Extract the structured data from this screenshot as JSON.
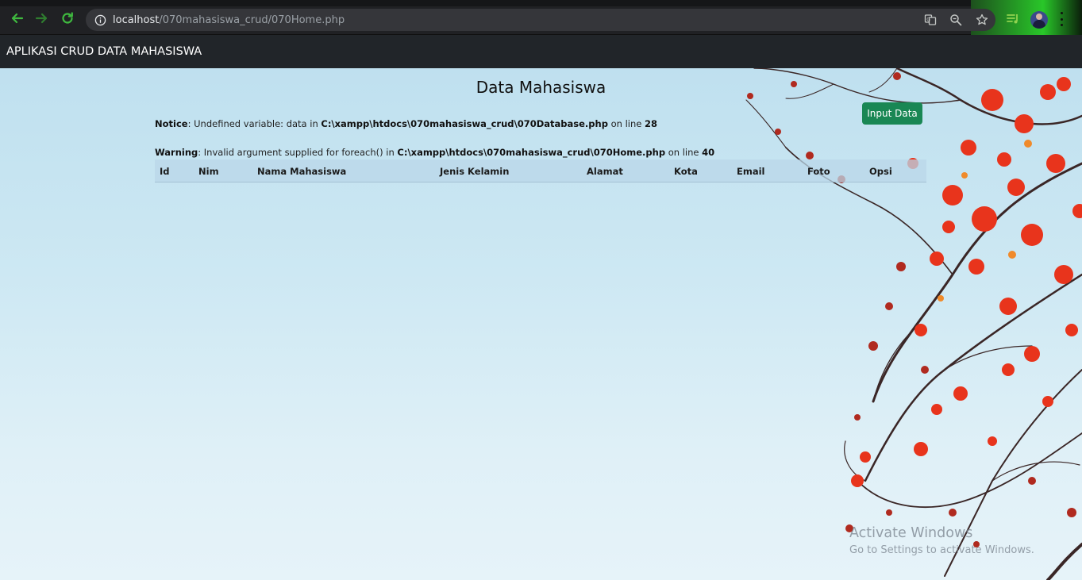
{
  "browser": {
    "url_host": "localhost",
    "url_path": "/070mahasiswa_crud/070Home.php",
    "icons": [
      "back-icon",
      "forward-icon",
      "reload-icon",
      "info-icon",
      "translate-icon",
      "zoom-icon",
      "star-icon",
      "media-icon",
      "profile-avatar",
      "menu-icon"
    ],
    "accent_green": "#29c729"
  },
  "navbar": {
    "brand": "APLIKASI CRUD DATA MAHASISWA"
  },
  "main": {
    "title": "Data Mahasiswa",
    "input_button": "Input Data",
    "notice": {
      "label": "Notice",
      "text": ": Undefined variable: data in ",
      "file": "C:\\xampp\\htdocs\\070mahasiswa_crud\\070Database.php",
      "on_line": " on line ",
      "line": "28"
    },
    "warning": {
      "label": "Warning",
      "text": ": Invalid argument supplied for foreach() in ",
      "file": "C:\\xampp\\htdocs\\070mahasiswa_crud\\070Home.php",
      "on_line": " on line ",
      "line": "40"
    },
    "table": {
      "columns": [
        "Id",
        "Nim",
        "Nama Mahasiswa",
        "Jenis Kelamin",
        "Alamat",
        "Kota",
        "Email",
        "Foto",
        "Opsi"
      ],
      "rows": []
    }
  },
  "watermark": {
    "title": "Activate Windows",
    "subtitle": "Go to Settings to activate Windows."
  },
  "colors": {
    "navbar_bg": "#212529",
    "button_bg": "#198754",
    "sky_light": "#dff0f7",
    "leaf_red": "#e8341c"
  }
}
